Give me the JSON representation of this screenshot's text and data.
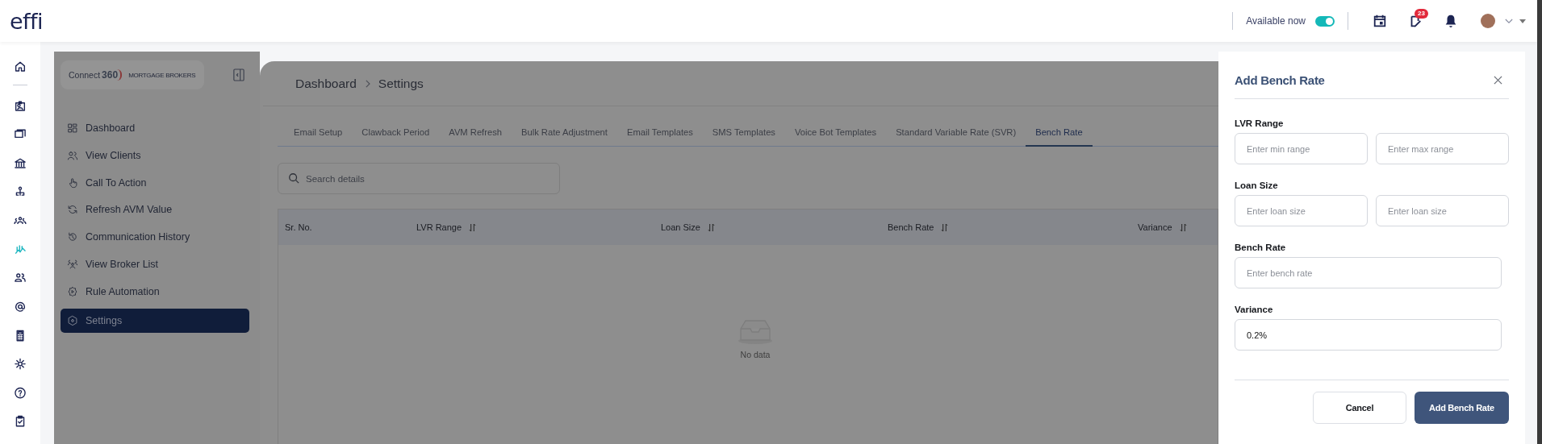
{
  "topbar": {
    "logo": "effi",
    "availability": {
      "label": "Available now",
      "on": true
    },
    "tasks_badge": "23"
  },
  "rail": [
    {
      "selected": false
    },
    {
      "selected": false
    },
    {
      "selected": false
    },
    {
      "selected": false
    },
    {
      "selected": false
    },
    {
      "selected": false
    },
    {
      "selected": true
    },
    {
      "selected": false
    },
    {
      "selected": false
    },
    {
      "selected": false
    },
    {
      "selected": false
    },
    {
      "selected": false
    },
    {
      "selected": false
    }
  ],
  "sidebar": {
    "brand": {
      "name": "Connect",
      "number": "360",
      "tagline": "MORTGAGE BROKERS"
    },
    "items": [
      {
        "label": "Dashboard",
        "selected": false
      },
      {
        "label": "View Clients",
        "selected": false
      },
      {
        "label": "Call To Action",
        "selected": false
      },
      {
        "label": "Refresh AVM Value",
        "selected": false
      },
      {
        "label": "Communication History",
        "selected": false
      },
      {
        "label": "View Broker List",
        "selected": false
      },
      {
        "label": "Rule Automation",
        "selected": false
      },
      {
        "label": "Settings",
        "selected": true
      }
    ]
  },
  "breadcrumb": [
    "Dashboard",
    "Settings"
  ],
  "tabs": [
    {
      "label": "Email Setup",
      "selected": false
    },
    {
      "label": "Clawback Period",
      "selected": false
    },
    {
      "label": "AVM Refresh",
      "selected": false
    },
    {
      "label": "Bulk Rate Adjustment",
      "selected": false
    },
    {
      "label": "Email Templates",
      "selected": false
    },
    {
      "label": "SMS Templates",
      "selected": false
    },
    {
      "label": "Voice Bot Templates",
      "selected": false
    },
    {
      "label": "Standard Variable Rate (SVR)",
      "selected": false
    },
    {
      "label": "Bench Rate",
      "selected": true
    }
  ],
  "search": {
    "placeholder": "Search details"
  },
  "table": {
    "columns": [
      {
        "label": "Sr. No.",
        "sortable": false
      },
      {
        "label": "LVR Range",
        "sortable": true
      },
      {
        "label": "Loan Size",
        "sortable": true
      },
      {
        "label": "Bench Rate",
        "sortable": true
      },
      {
        "label": "Variance",
        "sortable": true
      }
    ],
    "empty_text": "No data"
  },
  "drawer": {
    "title": "Add Bench Rate",
    "groups": [
      {
        "label": "LVR Range",
        "inputs": [
          {
            "placeholder": "Enter min range"
          },
          {
            "placeholder": "Enter max range"
          }
        ]
      },
      {
        "label": "Loan Size",
        "inputs": [
          {
            "placeholder": "Enter loan size"
          },
          {
            "placeholder": "Enter loan size"
          }
        ]
      },
      {
        "label": "Bench Rate",
        "inputs": [
          {
            "placeholder": "Enter bench rate"
          }
        ]
      },
      {
        "label": "Variance",
        "inputs": [
          {
            "value": "0.2%"
          }
        ]
      }
    ],
    "buttons": [
      {
        "label": "Cancel",
        "kind": "secondary"
      },
      {
        "label": "Add Bench Rate",
        "kind": "primary"
      }
    ]
  }
}
